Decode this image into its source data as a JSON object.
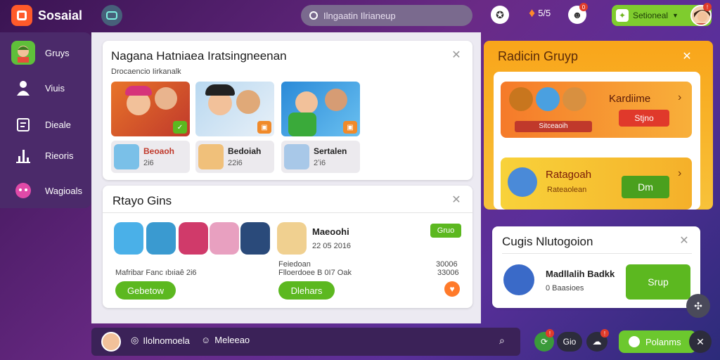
{
  "app": {
    "name": "Sosaial"
  },
  "search": {
    "placeholder": "Ilngaatin Ilrianeup"
  },
  "topbar": {
    "currency": "5/5",
    "user_label": "Setioneal"
  },
  "sidebar": {
    "items": [
      {
        "label": "Gruys",
        "icon": "group-avatar-icon"
      },
      {
        "label": "Viuis",
        "icon": "person-icon"
      },
      {
        "label": "Dieale",
        "icon": "clipboard-icon"
      },
      {
        "label": "Rieoris",
        "icon": "bar-chart-icon"
      },
      {
        "label": "Wagioals",
        "icon": "pink-avatar-icon"
      }
    ]
  },
  "feature_card": {
    "title": "Nagana Hatniaea Iratsingneenan",
    "subtitle": "Drocaencio Iirkanalk",
    "members": [
      {
        "name": "Beoaoh",
        "count": "2i6"
      },
      {
        "name": "Bedoiah",
        "count": "22i6"
      },
      {
        "name": "Sertalen",
        "count": "2ʼi6"
      }
    ]
  },
  "groups_card": {
    "title": "Rtayo Gins",
    "member_name": "Maeoohi",
    "member_date": "22 05 2016",
    "badge": "Gruo",
    "footer_left": "Mafribar Fanc ıbıiaê 2i6",
    "footer_mid_1": "Feiedoan",
    "footer_mid_2": "Flloerdoee B 0I7 Oak",
    "footer_right_1": "30006",
    "footer_right_2": "33006",
    "btn_left": "Gebetow",
    "btn_right": "Dlehars"
  },
  "radio_card": {
    "title": "Radicin Gruyp",
    "banner1_title": "Kardiime",
    "banner1_btn": "Stjno",
    "banner1_caption": "Sitceaoih",
    "banner2_title": "Ratagoah",
    "banner2_sub": "Rateaolean",
    "banner2_btn": "Dm"
  },
  "notify_card": {
    "title": "Cugis Nlutogoion",
    "name": "Madllalih Badkk",
    "sub": "0 Baasioes",
    "btn": "Srup"
  },
  "bottombar": {
    "item1": "Ilolnomoela",
    "item2": "Meleeao",
    "chip": "Gio",
    "action": "Polanms"
  },
  "colors": {
    "brand": "#ff5a2a",
    "accent_green": "#5cb820",
    "panel_orange": "#f9a51a"
  }
}
